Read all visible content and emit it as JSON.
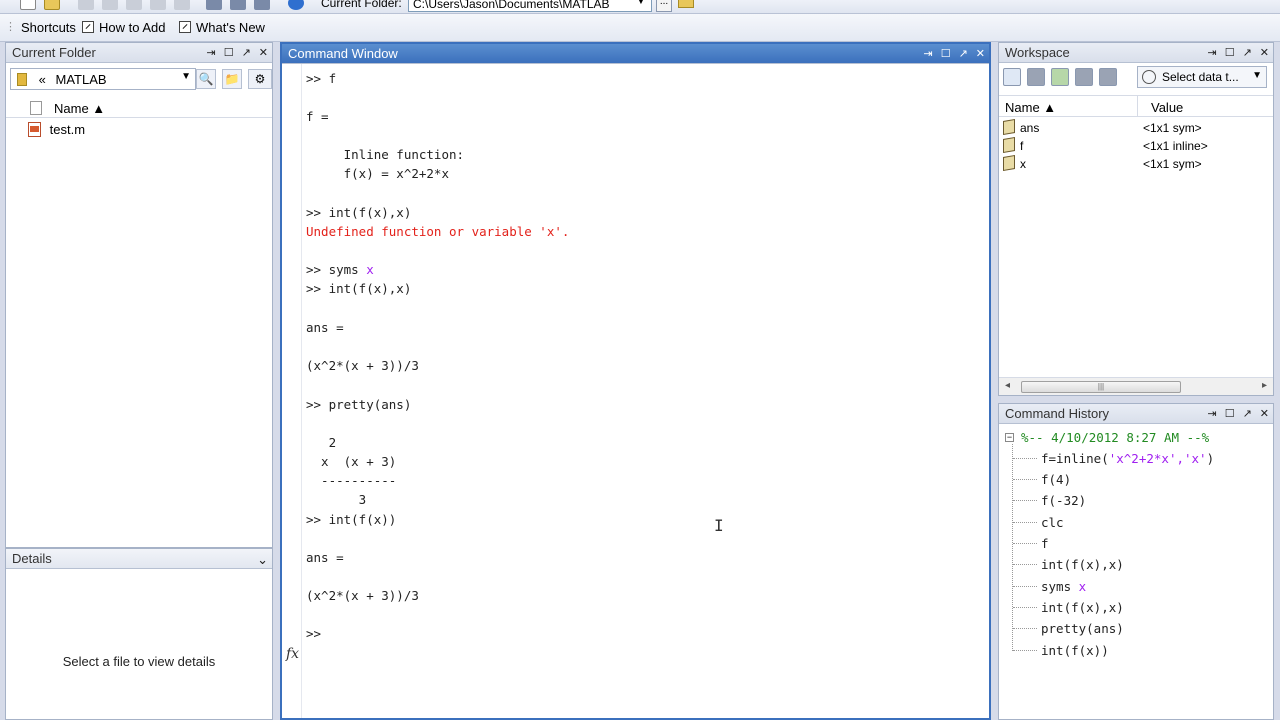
{
  "toolbar": {
    "current_folder_label": "Current Folder:",
    "current_folder_path": "C:\\Users\\Jason\\Documents\\MATLAB",
    "browse_label": "..."
  },
  "shortcuts": {
    "items": [
      {
        "label": "Shortcuts"
      },
      {
        "label": "How to Add"
      },
      {
        "label": "What's New"
      }
    ]
  },
  "current_folder_panel": {
    "title": "Current Folder",
    "address": "MATLAB",
    "breadcrumb_chevron": "«",
    "column_name": "Name ▲",
    "files": [
      {
        "name": "test.m"
      }
    ]
  },
  "details_panel": {
    "title": "Details",
    "empty_text": "Select a file to view details"
  },
  "command_window": {
    "title": "Command Window",
    "lines": [
      {
        "text": ">> f",
        "type": "normal"
      },
      {
        "text": "f =",
        "type": "normal"
      },
      {
        "text": "     Inline function:",
        "type": "normal"
      },
      {
        "text": "     f(x) = x^2+2*x",
        "type": "normal"
      },
      {
        "text": ">> int(f(x),x)",
        "type": "normal"
      },
      {
        "text": "Undefined function or variable 'x'.",
        "type": "error"
      },
      {
        "text": ">> syms ",
        "suffix": "x",
        "type": "syms"
      },
      {
        "text": ">> int(f(x),x)",
        "type": "normal"
      },
      {
        "text": "ans =",
        "type": "normal"
      },
      {
        "text": "(x^2*(x + 3))/3",
        "type": "normal"
      },
      {
        "text": ">> pretty(ans)",
        "type": "normal"
      },
      {
        "text": "   2",
        "type": "normal"
      },
      {
        "text": "  x  (x + 3)",
        "type": "normal"
      },
      {
        "text": "  ----------",
        "type": "normal"
      },
      {
        "text": "       3",
        "type": "normal"
      },
      {
        "text": ">> int(f(x))",
        "type": "normal"
      },
      {
        "text": "ans =",
        "type": "normal"
      },
      {
        "text": "(x^2*(x + 3))/3",
        "type": "normal"
      },
      {
        "text": ">>",
        "type": "prompt"
      }
    ],
    "fx_label": "fx"
  },
  "workspace": {
    "title": "Workspace",
    "select_data_label": "Select data t...",
    "column_name": "Name ▲",
    "column_value": "Value",
    "variables": [
      {
        "name": "ans",
        "value": "<1x1 sym>"
      },
      {
        "name": "f",
        "value": "<1x1 inline>"
      },
      {
        "name": "x",
        "value": "<1x1 sym>"
      }
    ]
  },
  "command_history": {
    "title": "Command History",
    "session_header": "%-- 4/10/2012 8:27 AM --%",
    "entries": [
      {
        "text": "f=inline(",
        "string_part": "'x^2+2*x','x'",
        "tail": ")"
      },
      {
        "text": "f(4)"
      },
      {
        "text": "f(-32)"
      },
      {
        "text": "clc"
      },
      {
        "text": "f"
      },
      {
        "text": "int(f(x),x)"
      },
      {
        "text": "syms ",
        "string_part": "x",
        "tail": ""
      },
      {
        "text": "int(f(x),x)"
      },
      {
        "text": "pretty(ans)"
      },
      {
        "text": "int(f(x))"
      }
    ]
  },
  "colors": {
    "active_title": "#3b70bd",
    "error_text": "#e3221b",
    "string_text": "#a020f0",
    "history_header": "#228b22"
  }
}
